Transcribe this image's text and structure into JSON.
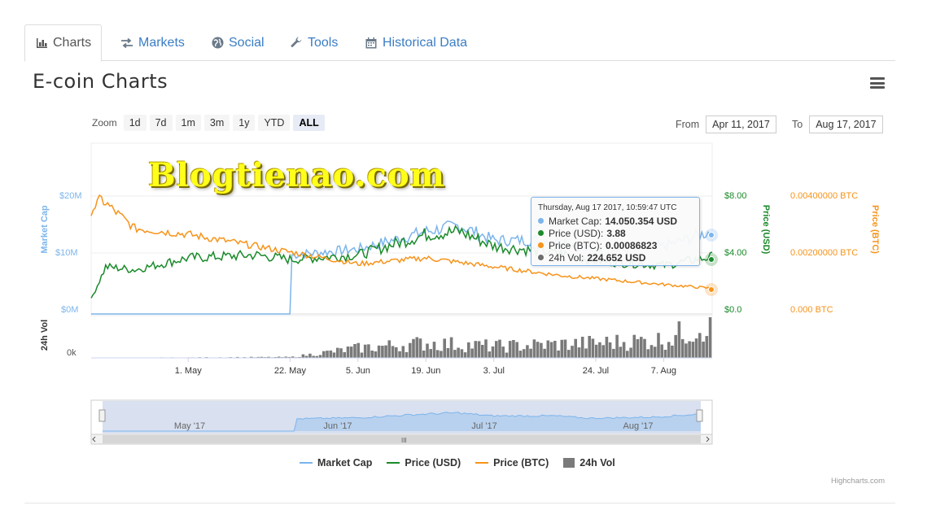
{
  "tabs": [
    {
      "label": "Charts",
      "icon": "bar-chart-icon",
      "active": true
    },
    {
      "label": "Markets",
      "icon": "exchange-arrows-icon"
    },
    {
      "label": "Social",
      "icon": "globe-icon"
    },
    {
      "label": "Tools",
      "icon": "wrench-icon"
    },
    {
      "label": "Historical Data",
      "icon": "calendar-icon"
    }
  ],
  "page_title": "E-coin Charts",
  "zoom": {
    "label": "Zoom",
    "buttons": [
      "1d",
      "7d",
      "1m",
      "3m",
      "1y",
      "YTD",
      "ALL"
    ],
    "selected": "ALL"
  },
  "range": {
    "from_label": "From",
    "from_value": "Apr 11, 2017",
    "to_label": "To",
    "to_value": "Aug 17, 2017"
  },
  "watermark": "Blogtienao.com",
  "tooltip": {
    "header": "Thursday, Aug 17 2017, 10:59:47 UTC",
    "rows": [
      {
        "label": "Market Cap:",
        "value": "14.050.354 USD",
        "color": "#7cb5ec"
      },
      {
        "label": "Price (USD):",
        "value": "3.88",
        "color": "#1a8a2a"
      },
      {
        "label": "Price (BTC):",
        "value": "0.00086823",
        "color": "#f7931a"
      },
      {
        "label": "24h Vol:",
        "value": "224.652 USD",
        "color": "#6d6d6d"
      }
    ]
  },
  "legend": [
    {
      "name": "Market Cap",
      "color": "#7cb5ec",
      "kind": "line"
    },
    {
      "name": "Price (USD)",
      "color": "#1a8a2a",
      "kind": "line"
    },
    {
      "name": "Price (BTC)",
      "color": "#f7931a",
      "kind": "line"
    },
    {
      "name": "24h Vol",
      "color": "#7a7a7a",
      "kind": "bar"
    }
  ],
  "credits": "Highcharts.com",
  "colors": {
    "market_cap": "#7cb5ec",
    "price_usd": "#1a8a2a",
    "price_btc": "#f7931a",
    "volume": "#7a7a7a",
    "tab_link": "#3a7dc4"
  },
  "chart_data": {
    "type": "line",
    "x_range": [
      "Apr 11, 2017",
      "Aug 17, 2017"
    ],
    "x_tick_labels": [
      "1. May",
      "22. May",
      "5. Jun",
      "19. Jun",
      "3. Jul",
      "24. Jul",
      "7. Aug"
    ],
    "axes": {
      "market_cap": {
        "label": "Market Cap",
        "ticks": [
          "$0M",
          "$10M",
          "$20M"
        ],
        "range": [
          0,
          20000000
        ]
      },
      "price_usd": {
        "label": "Price (USD)",
        "ticks": [
          "$0.0",
          "$4.00",
          "$8.00"
        ],
        "range": [
          0,
          8
        ]
      },
      "price_btc": {
        "label": "Price (BTC)",
        "ticks": [
          "0.000 BTC",
          "0.00200000 BTC",
          "0.00400000 BTC"
        ],
        "range": [
          0,
          0.004
        ]
      },
      "volume": {
        "label": "24h Vol",
        "ticks": [
          "0k"
        ]
      }
    },
    "series": [
      {
        "name": "Market Cap",
        "x": [
          "Apr 11",
          "May 21",
          "May 22",
          "Jun 5",
          "Jun 19",
          "Jun 26",
          "Jul 3",
          "Jul 17",
          "Jul 24",
          "Aug 7",
          "Aug 17"
        ],
        "values": [
          0,
          0,
          10000000,
          11000000,
          14000000,
          15000000,
          12500000,
          12500000,
          10500000,
          11500000,
          14050354
        ]
      },
      {
        "name": "Price (USD)",
        "x": [
          "Apr 11",
          "Apr 14",
          "Apr 20",
          "May 1",
          "May 15",
          "May 22",
          "Jun 5",
          "Jun 19",
          "Jun 26",
          "Jul 3",
          "Jul 17",
          "Jul 24",
          "Aug 7",
          "Aug 17"
        ],
        "values": [
          1.0,
          3.2,
          3.0,
          3.8,
          4.0,
          3.7,
          4.0,
          5.4,
          5.6,
          4.6,
          4.1,
          3.6,
          3.3,
          3.88
        ]
      },
      {
        "name": "Price (BTC)",
        "x": [
          "Apr 11",
          "Apr 13",
          "Apr 20",
          "May 1",
          "May 15",
          "May 22",
          "Jun 5",
          "Jun 19",
          "Jul 3",
          "Jul 17",
          "Jul 24",
          "Aug 7",
          "Aug 17"
        ],
        "values": [
          0.0035,
          0.0039,
          0.0029,
          0.0027,
          0.0023,
          0.0021,
          0.0017,
          0.0019,
          0.0016,
          0.0013,
          0.0012,
          0.001,
          0.00086823
        ]
      },
      {
        "name": "24h Vol",
        "x": [
          "Apr 11",
          "May 22",
          "Jun 5",
          "Jun 19",
          "Jul 3",
          "Jul 24",
          "Aug 7",
          "Aug 17"
        ],
        "values": [
          0,
          5000,
          60000,
          90000,
          70000,
          90000,
          110000,
          224652
        ]
      }
    ],
    "navigator_labels": [
      "May '17",
      "Jun '17",
      "Jul '17",
      "Aug '17"
    ]
  }
}
